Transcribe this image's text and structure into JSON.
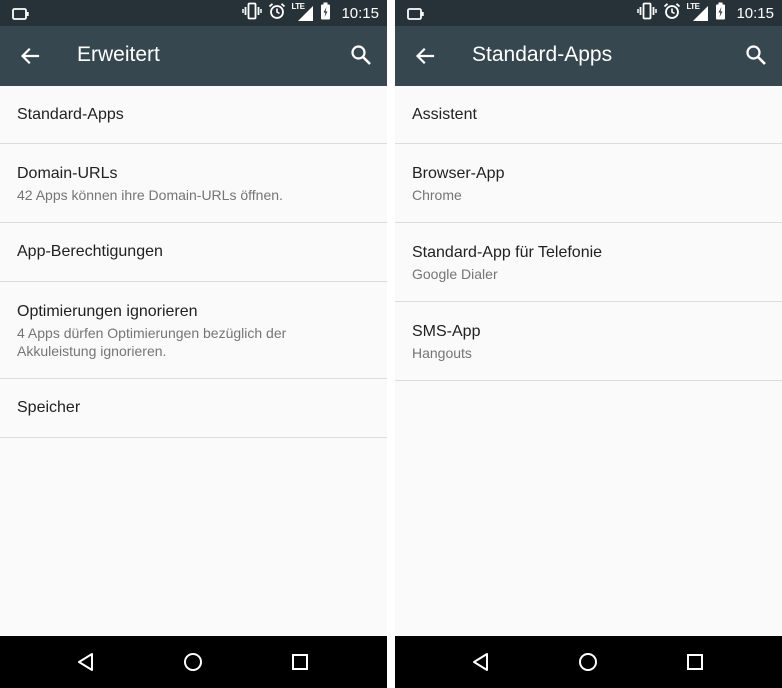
{
  "status_bar": {
    "time": "10:15",
    "network": "LTE"
  },
  "left": {
    "toolbar_title": "Erweitert",
    "items": [
      {
        "title": "Standard-Apps"
      },
      {
        "title": "Domain-URLs",
        "subtitle": "42 Apps können ihre Domain-URLs öffnen."
      },
      {
        "title": "App-Berechtigungen"
      },
      {
        "title": "Optimierungen ignorieren",
        "subtitle": "4 Apps dürfen Optimierungen bezüglich der Akkuleistung ignorieren."
      },
      {
        "title": "Speicher"
      }
    ]
  },
  "right": {
    "toolbar_title": "Standard-Apps",
    "items": [
      {
        "title": "Assistent"
      },
      {
        "title": "Browser-App",
        "subtitle": "Chrome"
      },
      {
        "title": "Standard-App für Telefonie",
        "subtitle": "Google Dialer"
      },
      {
        "title": "SMS-App",
        "subtitle": "Hangouts"
      }
    ]
  },
  "icons": {
    "status": [
      "battery-saver-icon",
      "vibrate-icon",
      "alarm-icon",
      "signal-icon",
      "battery-icon"
    ],
    "toolbar": [
      "back-arrow-icon",
      "search-icon"
    ],
    "nav": [
      "nav-back-icon",
      "nav-home-icon",
      "nav-recents-icon"
    ]
  },
  "colors": {
    "status_bar": "#263238",
    "toolbar": "#37474f",
    "background": "#fafafa",
    "divider": "#dcdcdc",
    "primary_text": "#212121",
    "secondary_text": "#757575",
    "nav_bar": "#000000"
  }
}
